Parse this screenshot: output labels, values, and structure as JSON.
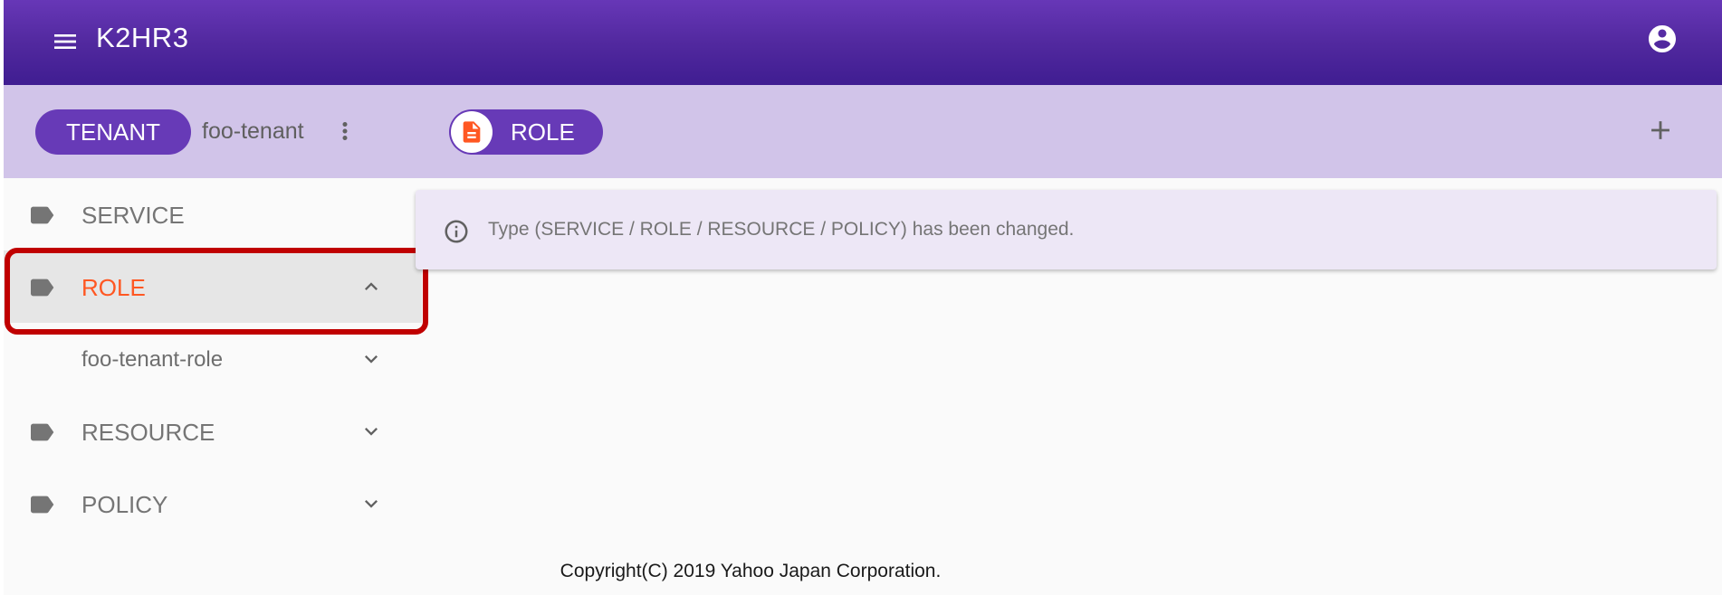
{
  "app": {
    "title": "K2HR3"
  },
  "toolbar": {
    "tenant_chip": "TENANT",
    "tenant_name": "foo-tenant",
    "type_chip": "ROLE"
  },
  "sidebar": {
    "items": [
      {
        "label": "SERVICE"
      },
      {
        "label": "ROLE"
      },
      {
        "label": "foo-tenant-role"
      },
      {
        "label": "RESOURCE"
      },
      {
        "label": "POLICY"
      }
    ]
  },
  "message": {
    "text": "Type (SERVICE / ROLE / RESOURCE / POLICY) has been changed."
  },
  "footer": {
    "copyright": "Copyright(C) 2019 Yahoo Japan Corporation."
  },
  "colors": {
    "appbar": "#5b2ea8",
    "toolbar": "#d1c4e9",
    "chip": "#673ab7",
    "active_label": "#ff5722",
    "highlight_border": "#c00000",
    "info_background": "#ede7f6"
  },
  "icons": [
    "menu-icon",
    "account-circle-icon",
    "more-vert-icon",
    "description-icon",
    "add-icon",
    "label-icon",
    "chevron-up-icon",
    "chevron-down-icon",
    "info-icon"
  ]
}
